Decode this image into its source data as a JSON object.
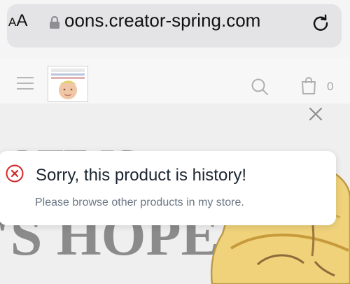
{
  "browser": {
    "text_size_label_large": "A",
    "text_size_label_small": "A",
    "url": "oons.creator-spring.com"
  },
  "store_header": {
    "cart_count": "0"
  },
  "hero": {
    "slogan_line_1": "OTE IS",
    "slogan_line_2": "'S HOPE"
  },
  "toast": {
    "title": "Sorry, this product is history!",
    "message": "Please browse other products in my store.",
    "accent_color": "#d62727"
  }
}
